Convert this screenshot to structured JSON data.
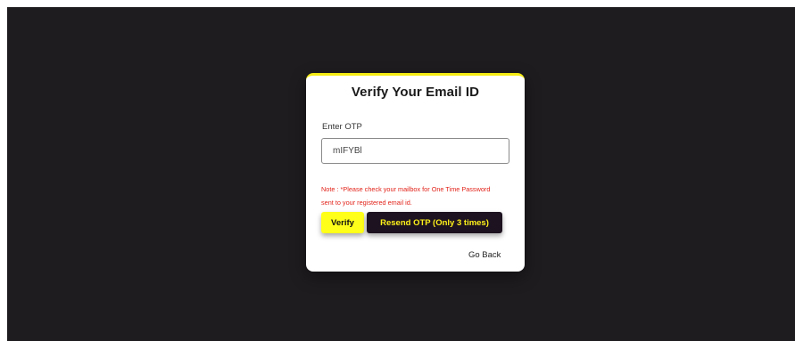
{
  "card": {
    "title": "Verify Your Email ID",
    "otp_label": "Enter OTP",
    "otp_value": "mIFYBl",
    "note": "Note : *Please check your mailbox for One Time Password sent to your registered email id.",
    "verify_label": "Verify",
    "resend_label": "Resend OTP (Only 3 times)",
    "go_back_label": "Go Back"
  },
  "colors": {
    "background": "#1f1c1f",
    "accent_yellow": "#ffff1a",
    "dark_button": "#1d1220",
    "note_red": "#e2231a"
  }
}
